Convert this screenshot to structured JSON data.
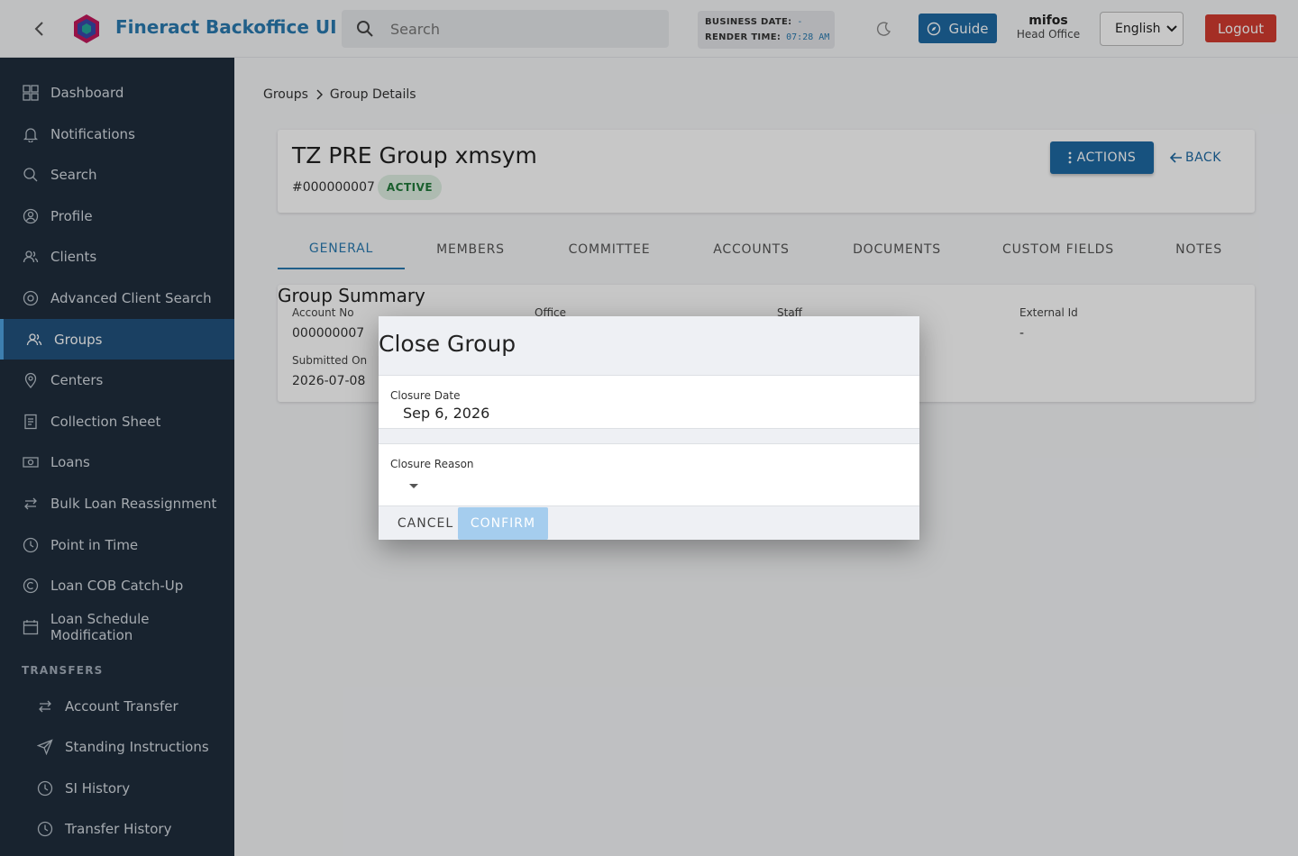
{
  "topbar": {
    "app_title": "Fineract Backoffice UI",
    "search_placeholder": "Search",
    "business_date_label": "BUSINESS DATE:",
    "business_date_value": "-",
    "render_time_label": "RENDER TIME:",
    "render_time_value": "07:28 AM",
    "guide_label": "Guide",
    "user_name": "mifos",
    "user_office": "Head Office",
    "language": "English",
    "logout_label": "Logout"
  },
  "sidebar": {
    "items": [
      {
        "label": "Dashboard",
        "icon": "dashboard-icon"
      },
      {
        "label": "Notifications",
        "icon": "bell-icon"
      },
      {
        "label": "Search",
        "icon": "search-icon"
      },
      {
        "label": "Profile",
        "icon": "user-circle-icon"
      },
      {
        "label": "Clients",
        "icon": "users-icon"
      },
      {
        "label": "Advanced Client Search",
        "icon": "target-icon"
      },
      {
        "label": "Groups",
        "icon": "group-icon"
      },
      {
        "label": "Centers",
        "icon": "map-pin-icon"
      },
      {
        "label": "Collection Sheet",
        "icon": "document-icon"
      },
      {
        "label": "Loans",
        "icon": "money-icon"
      },
      {
        "label": "Bulk Loan Reassignment",
        "icon": "swap-icon"
      },
      {
        "label": "Point in Time",
        "icon": "clock-icon"
      },
      {
        "label": "Loan COB Catch-Up",
        "icon": "refresh-icon"
      },
      {
        "label": "Loan Schedule Modification",
        "icon": "calendar-icon"
      }
    ],
    "transfers_label": "TRANSFERS",
    "transfer_items": [
      {
        "label": "Account Transfer",
        "icon": "swap-icon"
      },
      {
        "label": "Standing Instructions",
        "icon": "send-icon"
      },
      {
        "label": "SI History",
        "icon": "clock-icon"
      },
      {
        "label": "Transfer History",
        "icon": "clock-icon"
      }
    ]
  },
  "breadcrumb": {
    "parent": "Groups",
    "current": "Group Details"
  },
  "header": {
    "group_name": "TZ PRE Group xmsym",
    "group_no": "#000000007",
    "status": "ACTIVE",
    "actions_label": "ACTIONS",
    "back_label": "BACK"
  },
  "tabs": [
    "GENERAL",
    "MEMBERS",
    "COMMITTEE",
    "ACCOUNTS",
    "DOCUMENTS",
    "CUSTOM FIELDS",
    "NOTES"
  ],
  "summary": {
    "title": "Group Summary",
    "account_no_label": "Account No",
    "account_no_value": "000000007",
    "office_label": "Office",
    "staff_label": "Staff",
    "external_id_label": "External Id",
    "external_id_value": "-",
    "submitted_on_label": "Submitted On",
    "submitted_on_value": "2026-07-08"
  },
  "dialog": {
    "title": "Close Group",
    "closure_date_label": "Closure Date",
    "closure_date_value": "Sep 6, 2026",
    "closure_reason_label": "Closure Reason",
    "cancel_label": "CANCEL",
    "confirm_label": "CONFIRM"
  },
  "colors": {
    "brand": "#2a7ab0",
    "primary_button": "#1e6aa3",
    "logout": "#d23c30",
    "sidebar_bg": "#1f2d3d",
    "sidebar_active": "#22527e"
  }
}
